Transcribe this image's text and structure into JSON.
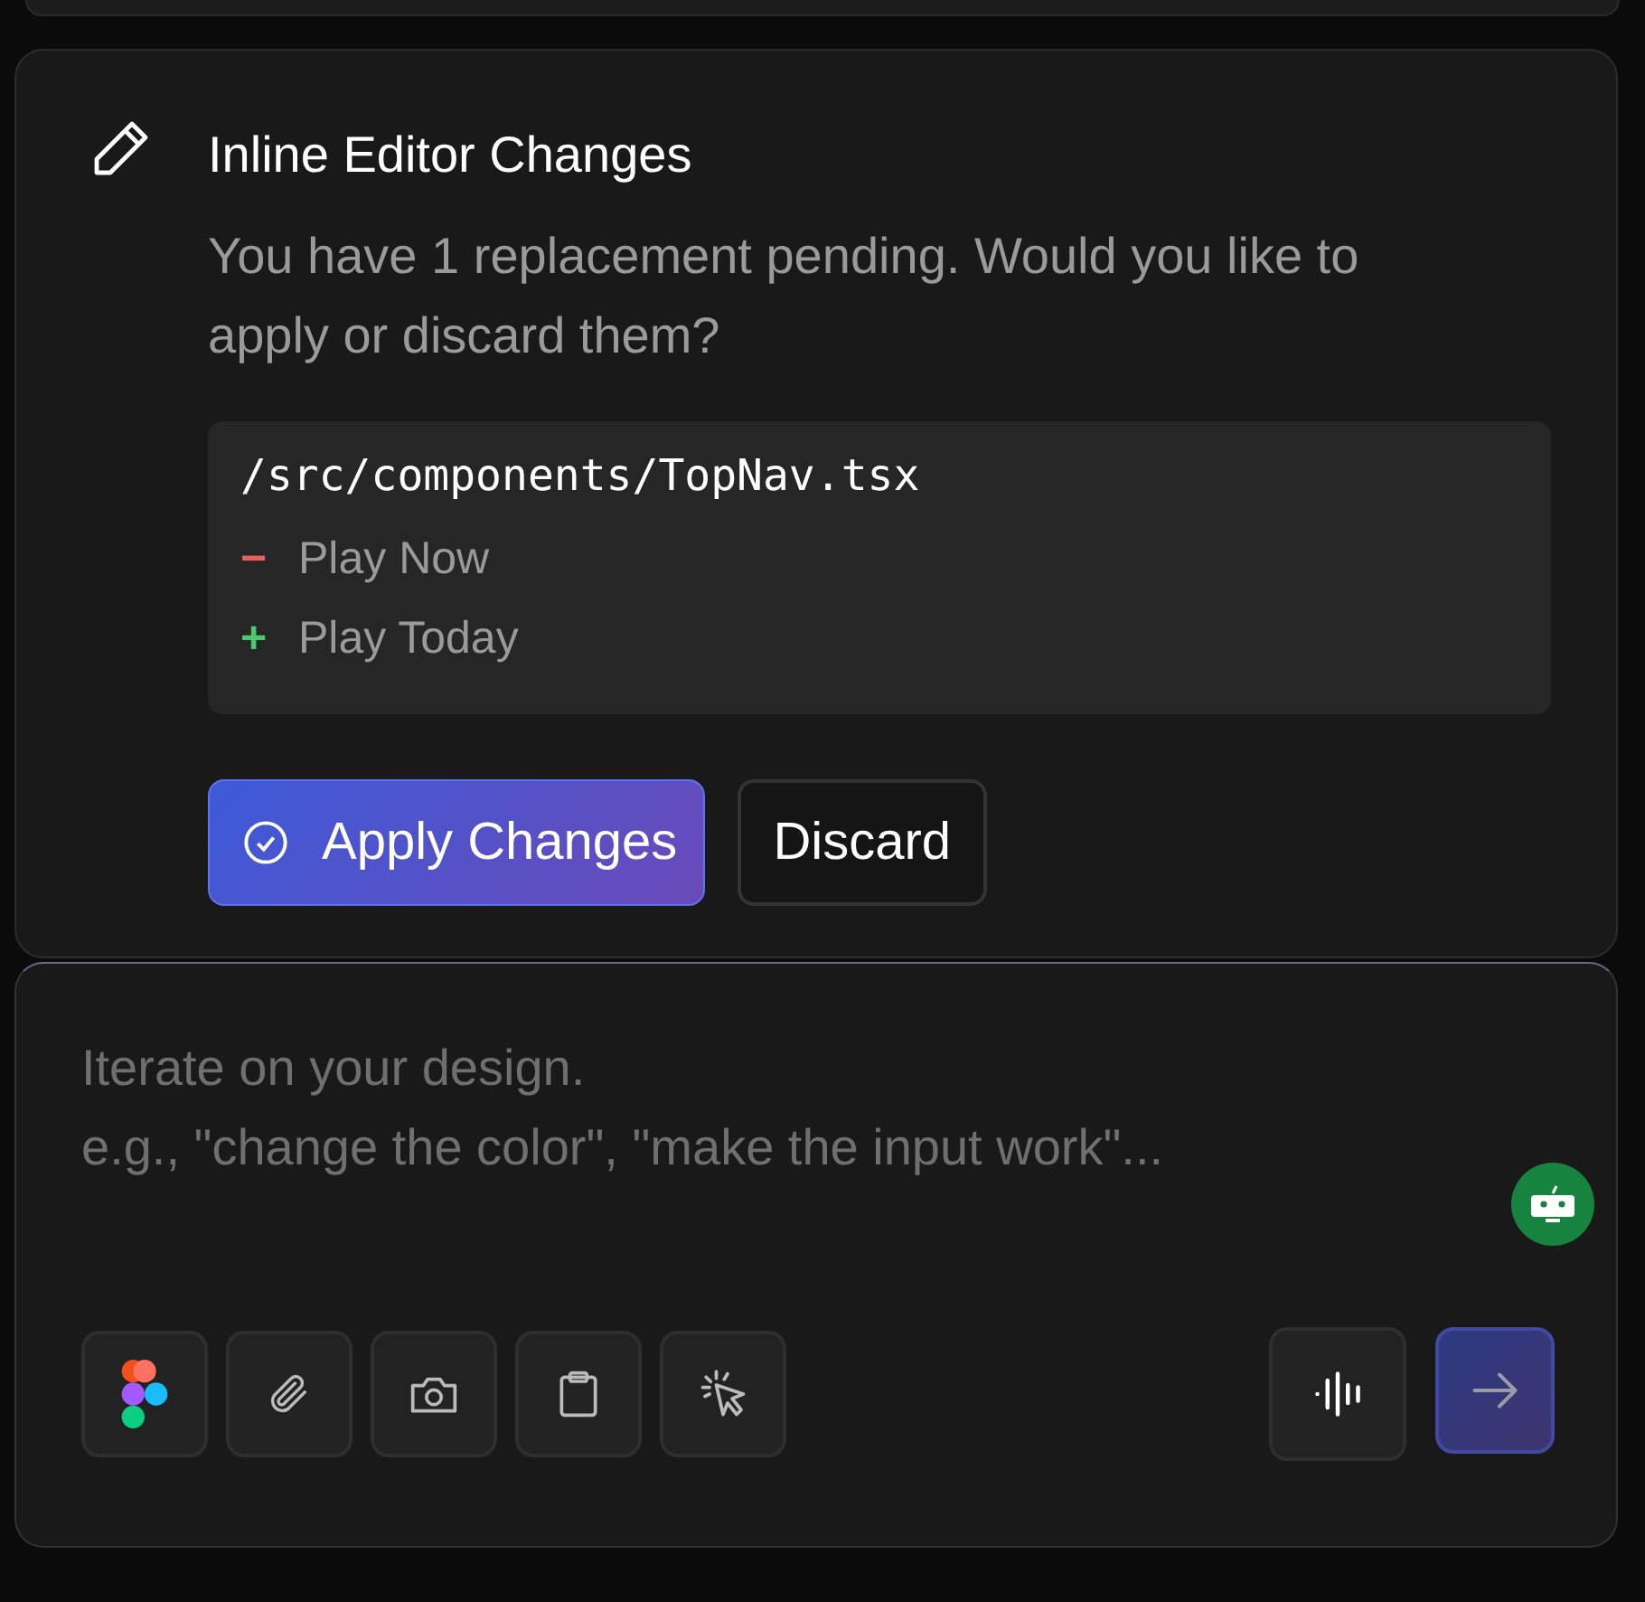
{
  "changes_card": {
    "title": "Inline Editor Changes",
    "message": "You have 1 replacement pending. Would you like to apply or discard them?",
    "diff": {
      "file": "/src/components/TopNav.tsx",
      "lines": [
        {
          "kind": "removed",
          "sign": "−",
          "text": "Play Now"
        },
        {
          "kind": "added",
          "sign": "+",
          "text": "Play Today"
        }
      ]
    },
    "buttons": [
      {
        "kind": "primary",
        "label": "Apply Changes"
      },
      {
        "kind": "secondary",
        "label": "Discard"
      }
    ]
  },
  "prompt": {
    "placeholder": "Iterate on your design.\ne.g., \"change the color\", \"make the input work\"...",
    "tools": [
      {
        "kind": "figma"
      },
      {
        "kind": "attach"
      },
      {
        "kind": "camera"
      },
      {
        "kind": "clipboard"
      },
      {
        "kind": "pointer"
      }
    ],
    "actions": [
      {
        "kind": "voice"
      },
      {
        "kind": "send"
      }
    ]
  }
}
